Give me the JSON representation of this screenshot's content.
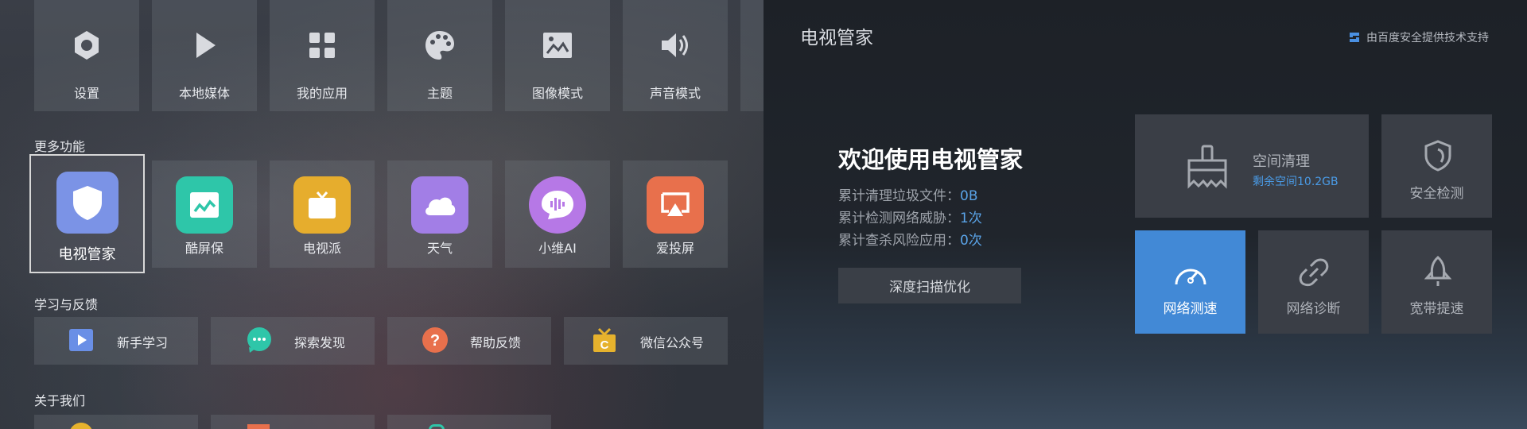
{
  "left": {
    "top_row": [
      {
        "label": "设置",
        "icon": "gear-icon"
      },
      {
        "label": "本地媒体",
        "icon": "play-icon"
      },
      {
        "label": "我的应用",
        "icon": "grid-icon"
      },
      {
        "label": "主题",
        "icon": "palette-icon"
      },
      {
        "label": "图像模式",
        "icon": "picture-icon"
      },
      {
        "label": "声音模式",
        "icon": "speaker-icon"
      }
    ],
    "more_title": "更多功能",
    "apps": [
      {
        "label": "电视管家",
        "icon": "shield-icon",
        "color": "#7b93e6"
      },
      {
        "label": "酷屏保",
        "icon": "screensaver-icon",
        "color": "#2ec6a9"
      },
      {
        "label": "电视派",
        "icon": "tv-icon",
        "color": "#e6ad2d"
      },
      {
        "label": "天气",
        "icon": "cloud-icon",
        "color": "#a27ee6"
      },
      {
        "label": "小维AI",
        "icon": "voice-icon",
        "color": "#b678e6"
      },
      {
        "label": "爱投屏",
        "icon": "cast-icon",
        "color": "#e8704c"
      }
    ],
    "learn_title": "学习与反馈",
    "learn": [
      {
        "label": "新手学习",
        "icon": "play-box-icon",
        "color": "#6a8fe6"
      },
      {
        "label": "探索发现",
        "icon": "chat-icon",
        "color": "#2ec6a9"
      },
      {
        "label": "帮助反馈",
        "icon": "help-icon",
        "color": "#e8704c"
      },
      {
        "label": "微信公众号",
        "icon": "gift-icon",
        "color": "#e6b22d"
      }
    ],
    "about_title": "关于我们"
  },
  "right": {
    "title": "电视管家",
    "badge": "由百度安全提供技术支持",
    "welcome": "欢迎使用电视管家",
    "stats": [
      {
        "label": "累计清理垃圾文件：",
        "value": "0B"
      },
      {
        "label": "累计检测网络威胁：",
        "value": "1次"
      },
      {
        "label": "累计查杀风险应用：",
        "value": "0次"
      }
    ],
    "scan_button": "深度扫描优化",
    "space_clean": {
      "label": "空间清理",
      "sub": "剩余空间10.2GB"
    },
    "security_check": "安全检测",
    "net_speed": "网络测速",
    "net_diag": "网络诊断",
    "broadband": "宽带提速"
  }
}
